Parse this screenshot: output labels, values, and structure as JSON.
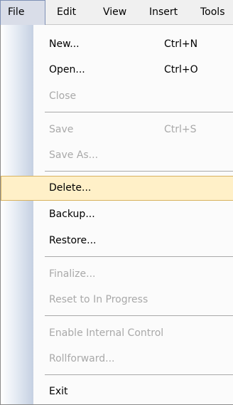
{
  "menubar": {
    "items": [
      {
        "label": "File"
      },
      {
        "label": "Edit"
      },
      {
        "label": "View"
      },
      {
        "label": "Insert"
      },
      {
        "label": "Tools"
      }
    ]
  },
  "file_menu": {
    "new": {
      "label": "New...",
      "shortcut": "Ctrl+N"
    },
    "open": {
      "label": "Open...",
      "shortcut": "Ctrl+O"
    },
    "close": {
      "label": "Close"
    },
    "save": {
      "label": "Save",
      "shortcut": "Ctrl+S"
    },
    "save_as": {
      "label": "Save As..."
    },
    "delete": {
      "label": "Delete..."
    },
    "backup": {
      "label": "Backup..."
    },
    "restore": {
      "label": "Restore..."
    },
    "finalize": {
      "label": "Finalize..."
    },
    "reset": {
      "label": "Reset to In Progress"
    },
    "enable_internal_control": {
      "label": "Enable Internal Control"
    },
    "rollforward": {
      "label": "Rollforward..."
    },
    "exit": {
      "label": "Exit"
    }
  },
  "colors": {
    "highlight_fill": "#fff0c8",
    "highlight_border": "#d8b25f",
    "disabled_text": "#a9a9a9",
    "gutter": "#c5d0e2"
  }
}
